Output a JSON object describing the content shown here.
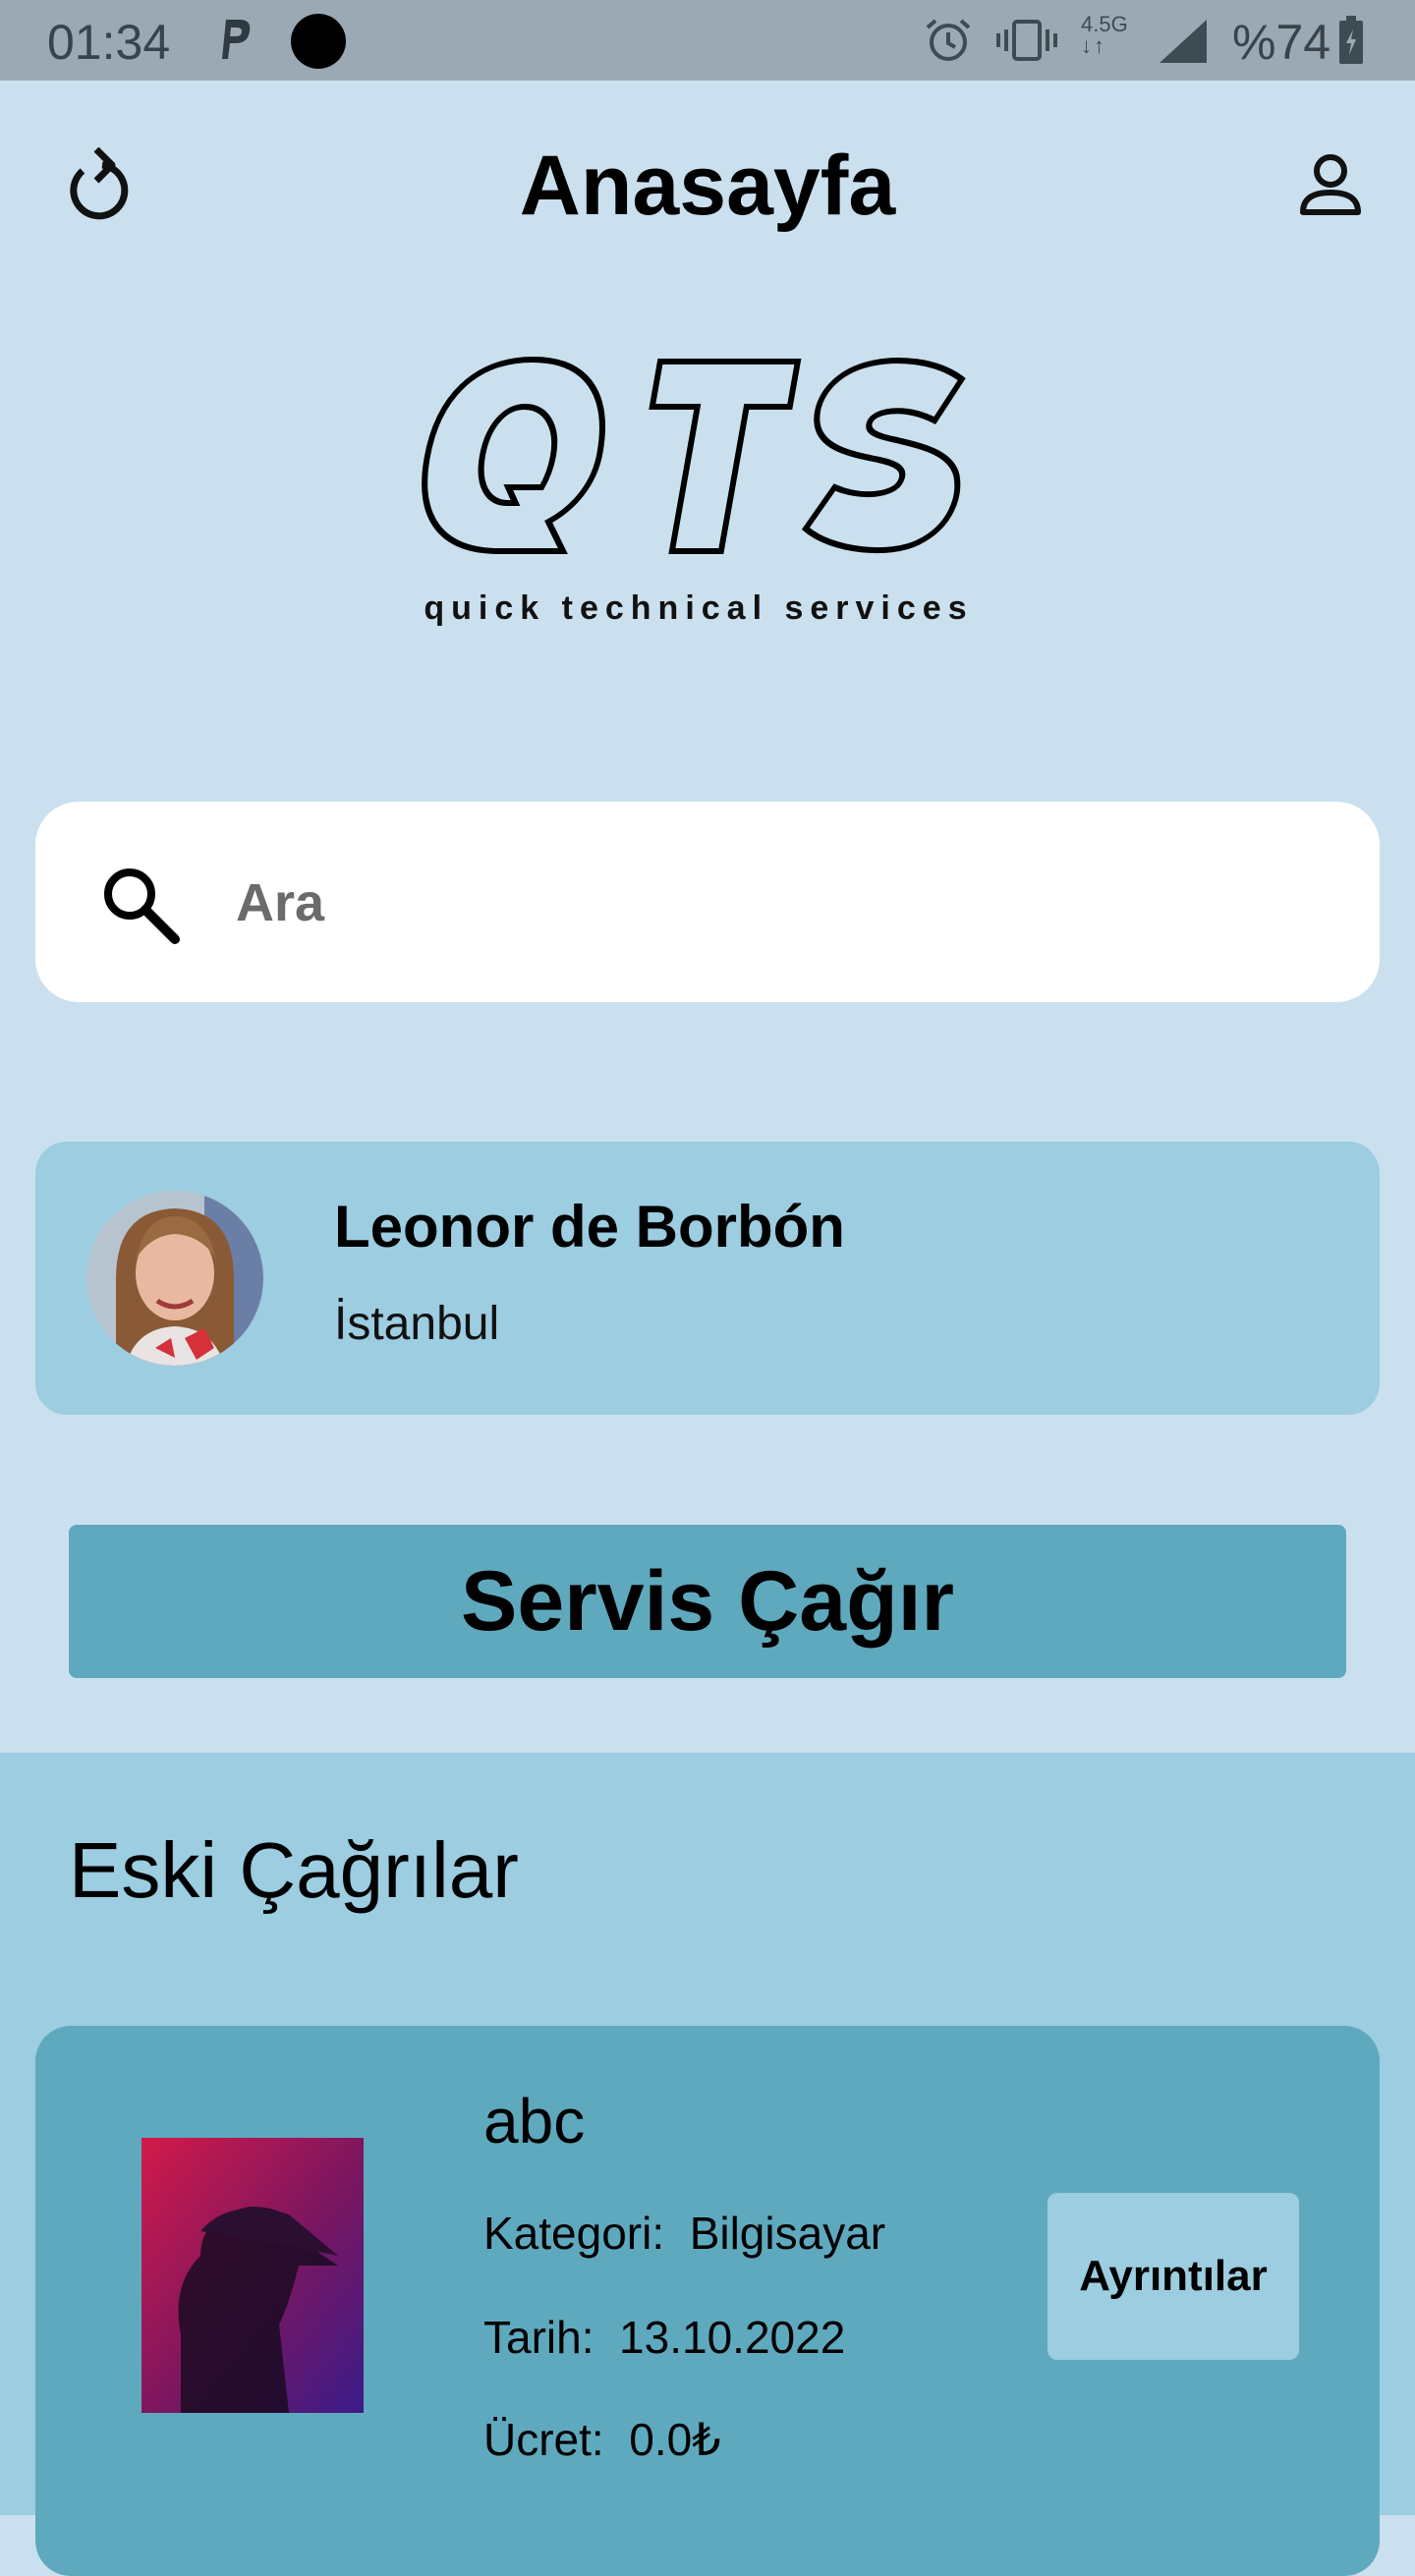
{
  "status_bar": {
    "time": "01:34",
    "network_label": "4.5G",
    "battery_text": "%74"
  },
  "app_bar": {
    "title": "Anasayfa",
    "back_icon": "refresh-icon",
    "account_icon": "person-icon"
  },
  "logo": {
    "letters": "QTS",
    "tagline": "quick technical services"
  },
  "search": {
    "placeholder": "Ara",
    "icon": "search-icon"
  },
  "profile": {
    "name": "Leonor de Borbón",
    "city": "İstanbul"
  },
  "service_button": {
    "label": "Servis Çağır"
  },
  "history": {
    "title": "Eski Çağrılar",
    "orders": [
      {
        "name": "abc",
        "category_label": "Kategori:",
        "category": "Bilgisayar",
        "date_label": "Tarih:",
        "date": "13.10.2022",
        "price_label": "Ücret:",
        "price": "0.0₺",
        "details_label": "Ayrıntılar"
      }
    ]
  },
  "colors": {
    "background": "#cbe0ee",
    "card_light": "#9ccde0",
    "accent": "#5fa9be",
    "status_bar": "#9aa9b4"
  }
}
